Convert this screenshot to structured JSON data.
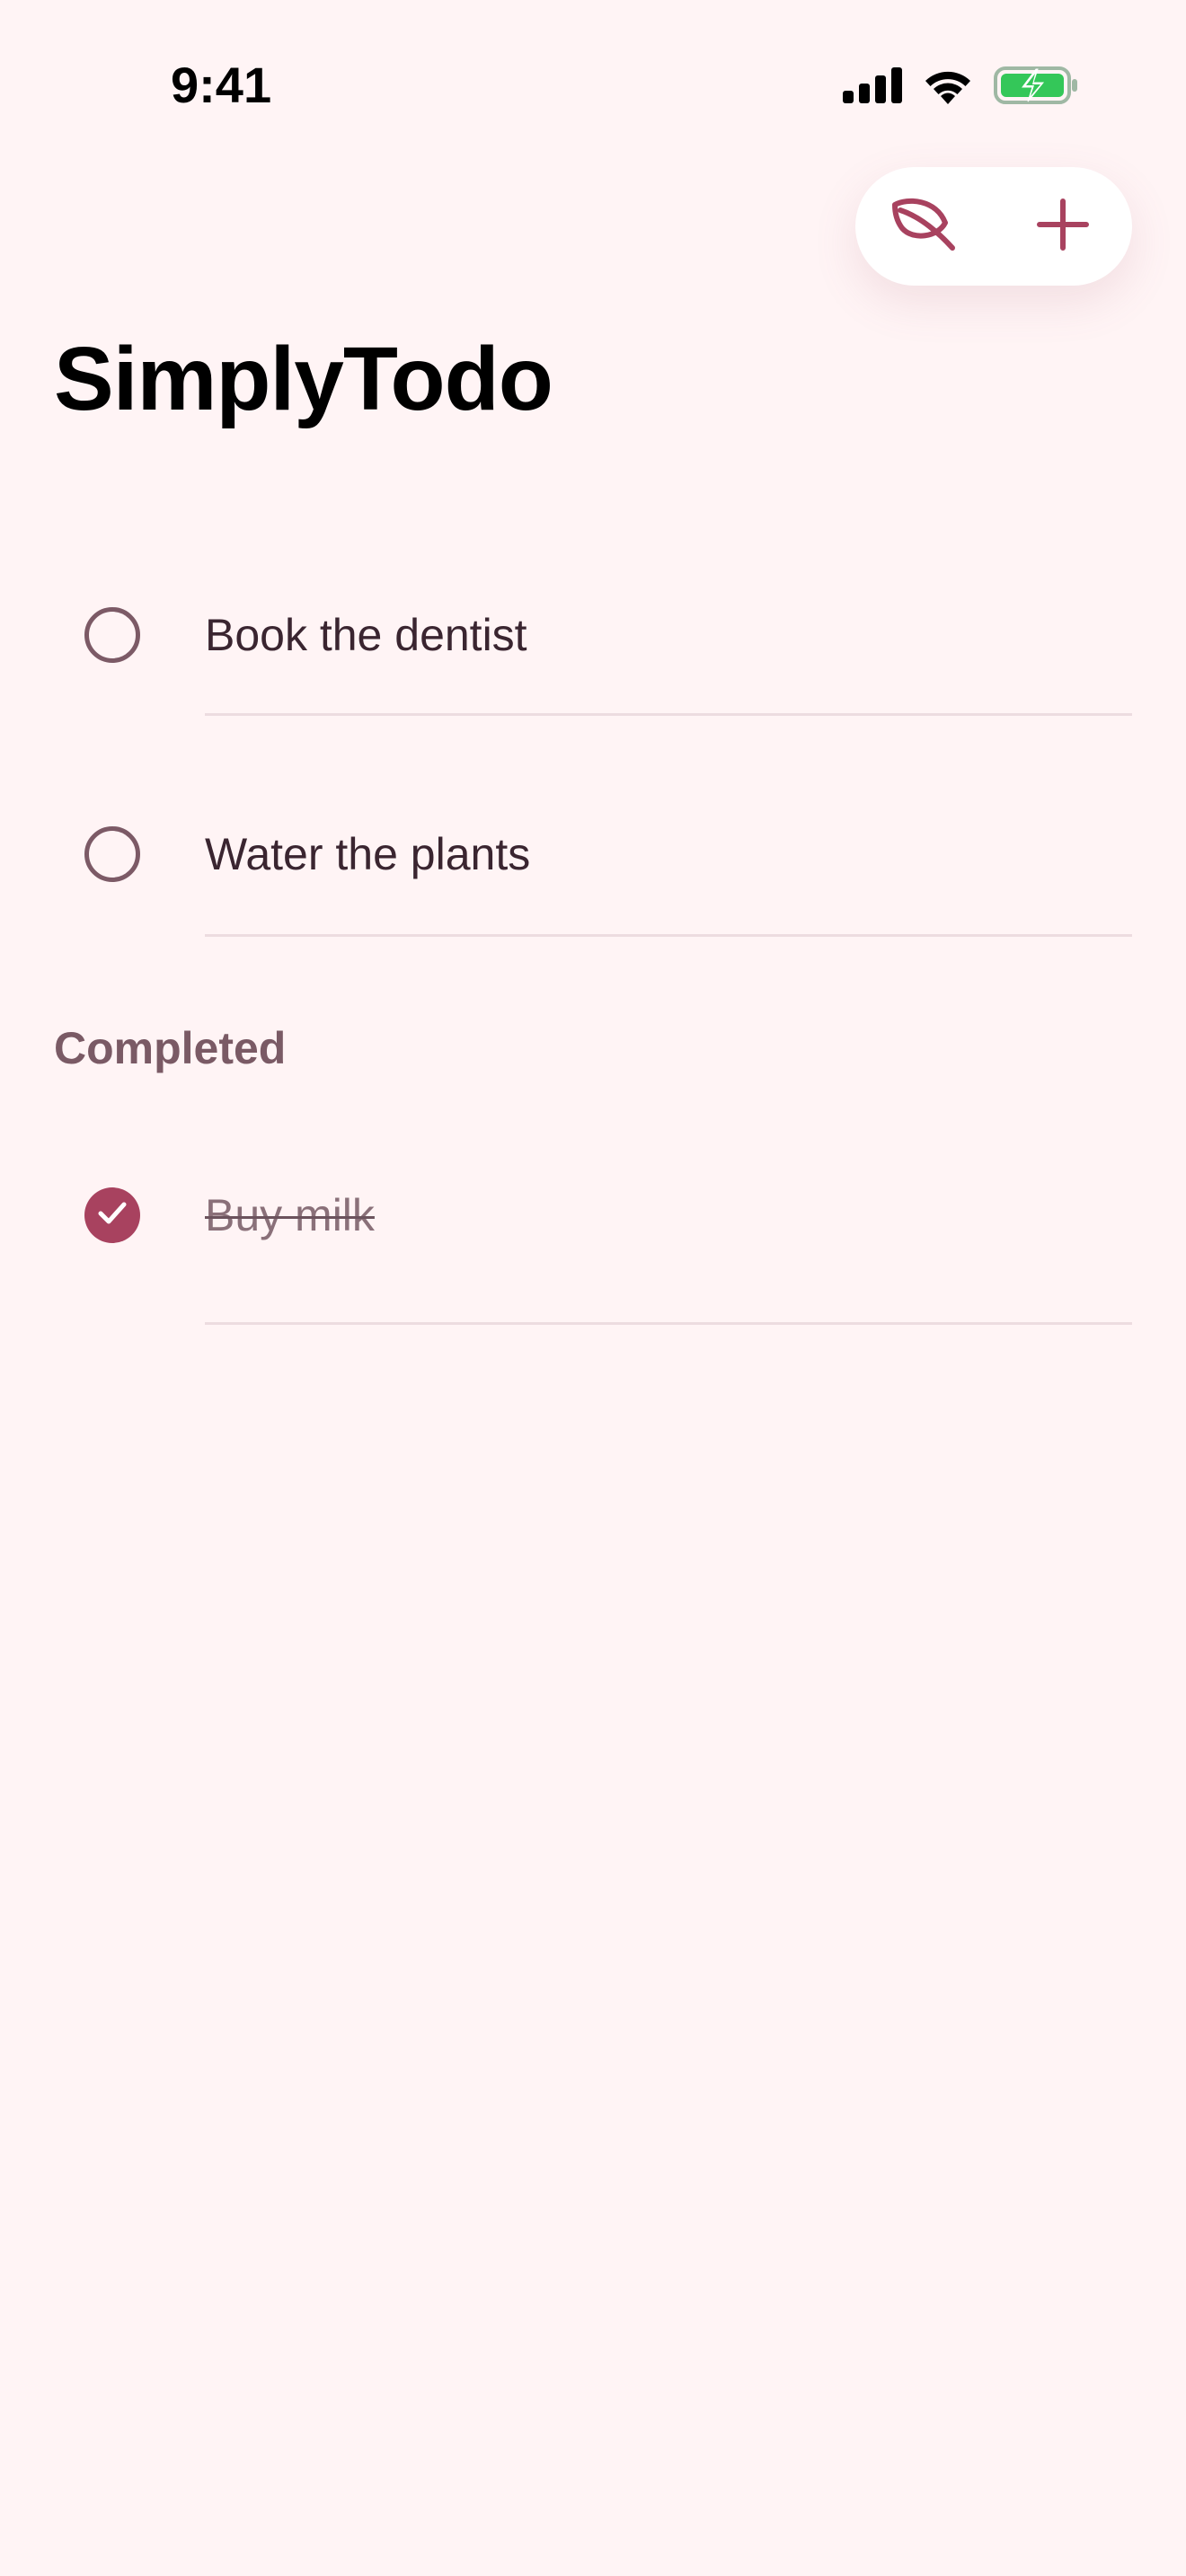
{
  "status_bar": {
    "time": "9:41",
    "icons": [
      "cellular-signal-icon",
      "wifi-icon",
      "battery-charging-icon"
    ],
    "battery_color": "#34C759"
  },
  "toolbar": {
    "buttons": [
      {
        "icon": "leaf-icon"
      },
      {
        "icon": "plus-icon"
      }
    ],
    "accent_color": "#A8425F"
  },
  "title": "SimplyTodo",
  "todos": [
    {
      "label": "Book the dentist",
      "completed": false
    },
    {
      "label": "Water the plants",
      "completed": false
    }
  ],
  "completed_section": {
    "header": "Completed",
    "items": [
      {
        "label": "Buy milk",
        "completed": true
      }
    ]
  },
  "colors": {
    "background": "#FFF4F5",
    "accent": "#A8425F",
    "text": "#3A2530",
    "section_header": "#7A5A65",
    "divider": "#EDDCE0"
  }
}
